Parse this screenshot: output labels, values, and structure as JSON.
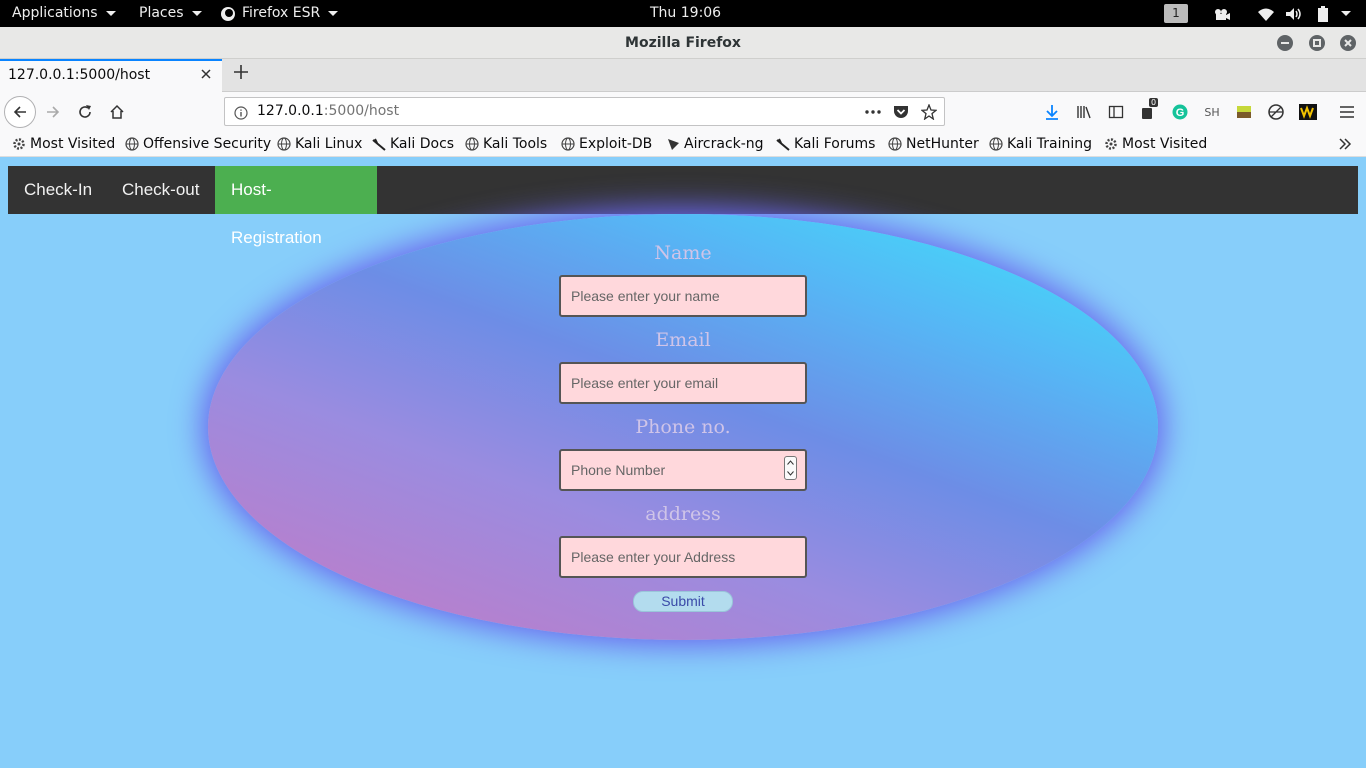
{
  "os_topbar": {
    "applications": "Applications",
    "places": "Places",
    "browser_menu": "Firefox ESR",
    "clock": "Thu 19:06",
    "workspace": "1"
  },
  "window": {
    "title": "Mozilla Firefox"
  },
  "tabs": [
    {
      "label": "127.0.0.1:5000/host",
      "active": true
    }
  ],
  "urlbar": {
    "host": "127.0.0.1",
    "path": ":5000/host"
  },
  "toolbar": {
    "badge_count": "0",
    "sh_label": "SH"
  },
  "bookmarks": [
    {
      "label": "Most Visited",
      "icon": "gear-icon"
    },
    {
      "label": "Offensive Security",
      "icon": "globe-icon"
    },
    {
      "label": "Kali Linux",
      "icon": "globe-icon"
    },
    {
      "label": "Kali Docs",
      "icon": "kali-dragon-icon"
    },
    {
      "label": "Kali Tools",
      "icon": "globe-icon"
    },
    {
      "label": "Exploit-DB",
      "icon": "globe-icon"
    },
    {
      "label": "Aircrack-ng",
      "icon": "aircrack-icon"
    },
    {
      "label": "Kali Forums",
      "icon": "kali-dragon-icon"
    },
    {
      "label": "NetHunter",
      "icon": "globe-icon"
    },
    {
      "label": "Kali Training",
      "icon": "globe-icon"
    },
    {
      "label": "Most Visited",
      "icon": "gear-icon"
    }
  ],
  "site_nav": {
    "items": [
      {
        "label": "Check-In",
        "active": false
      },
      {
        "label": "Check-out",
        "active": false
      },
      {
        "label": "Host-Registration",
        "active": true
      }
    ]
  },
  "form": {
    "name_label": "Name",
    "name_placeholder": "Please enter your name",
    "email_label": "Email",
    "email_placeholder": "Please enter your email",
    "phone_label": "Phone no.",
    "phone_placeholder": "Phone Number",
    "address_label": "address",
    "address_placeholder": "Please enter your Address",
    "submit_label": "Submit"
  },
  "colors": {
    "page_bg": "#87cefa",
    "nav_bg": "#333333",
    "nav_active": "#4caf50",
    "input_bg": "#ffd8dc"
  }
}
